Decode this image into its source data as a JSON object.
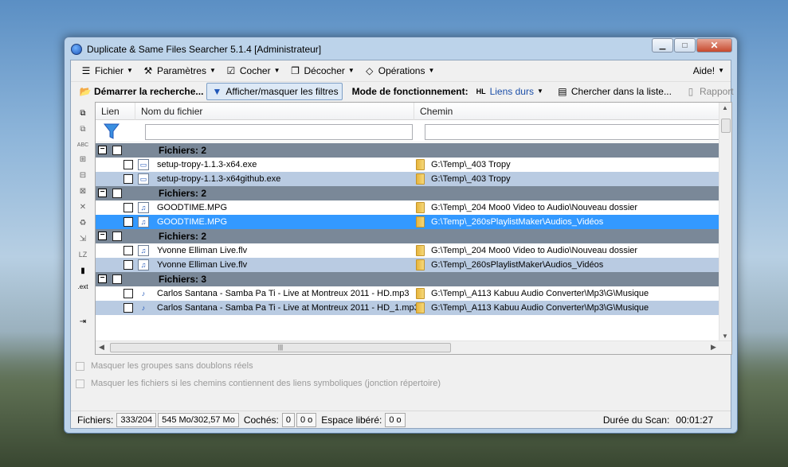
{
  "window": {
    "title": "Duplicate & Same Files Searcher 5.1.4 [Administrateur]",
    "minimize_glyph": "▁",
    "maximize_glyph": "□",
    "close_glyph": "✕"
  },
  "menu": {
    "items": [
      {
        "label": "Fichier",
        "icon": "file-menu-icon"
      },
      {
        "label": "Paramètres",
        "icon": "settings-tools-icon"
      },
      {
        "label": "Cocher",
        "icon": "check-menu-icon"
      },
      {
        "label": "Décocher",
        "icon": "uncheck-menu-icon"
      },
      {
        "label": "Opérations",
        "icon": "operations-icon"
      }
    ],
    "help": "Aide!"
  },
  "toolbar": {
    "start_search": "Démarrer la recherche...",
    "toggle_filters": "Afficher/masquer les filtres",
    "mode_label": "Mode de fonctionnement:",
    "mode_value": "Liens durs",
    "mode_icon_text": "HL",
    "search_list": "Chercher dans la liste...",
    "report": "Rapport"
  },
  "grid": {
    "columns": [
      "Lien",
      "Nom du fichier",
      "Chemin"
    ],
    "group_label": "Fichiers:",
    "groups": [
      {
        "count": "2",
        "files": [
          {
            "name": "setup-tropy-1.1.3-x64.exe",
            "path": "G:\\Temp\\_403 Tropy",
            "style": "white",
            "icon": "executable-file-icon"
          },
          {
            "name": "setup-tropy-1.1.3-x64github.exe",
            "path": "G:\\Temp\\_403 Tropy",
            "style": "alt",
            "icon": "executable-file-icon"
          }
        ]
      },
      {
        "count": "2",
        "files": [
          {
            "name": "GOODTIME.MPG",
            "path": "G:\\Temp\\_204 Moo0 Video to Audio\\Nouveau dossier",
            "style": "white",
            "icon": "video-file-icon"
          },
          {
            "name": "GOODTIME.MPG",
            "path": "G:\\Temp\\_260sPlaylistMaker\\Audios_Vidéos",
            "style": "selected",
            "icon": "video-file-icon"
          }
        ]
      },
      {
        "count": "2",
        "files": [
          {
            "name": "Yvonne Elliman Live.flv",
            "path": "G:\\Temp\\_204 Moo0 Video to Audio\\Nouveau dossier",
            "style": "white",
            "icon": "video-file-icon"
          },
          {
            "name": "Yvonne Elliman Live.flv",
            "path": "G:\\Temp\\_260sPlaylistMaker\\Audios_Vidéos",
            "style": "alt",
            "icon": "video-file-icon"
          }
        ]
      },
      {
        "count": "3",
        "files": [
          {
            "name": "Carlos Santana - Samba Pa Ti  - Live at Montreux 2011 - HD.mp3",
            "path": "G:\\Temp\\_A113  Kabuu Audio Converter\\Mp3\\G\\Musique",
            "style": "white",
            "icon": "audio-file-icon"
          },
          {
            "name": "Carlos Santana - Samba Pa Ti  - Live at Montreux 2011 - HD_1.mp3",
            "path": "G:\\Temp\\_A113  Kabuu Audio Converter\\Mp3\\G\\Musique",
            "style": "alt",
            "icon": "audio-file-icon"
          }
        ]
      }
    ]
  },
  "options": {
    "hide_groups": "Masquer les groupes sans doublons réels",
    "hide_symlinks": "Masquer les fichiers si les chemins contiennent des liens symboliques (jonction répertoire)"
  },
  "status": {
    "files_label": "Fichiers:",
    "files_count": "333/204",
    "size": "545 Mo/302,57 Mo",
    "checked_label": "Cochés:",
    "checked_count": "0",
    "checked_size": "0 o",
    "freed_label": "Espace libéré:",
    "freed_value": "0 o",
    "duration_label": "Durée du Scan:",
    "duration_value": "00:01:27"
  },
  "colors": {
    "group_row": "#7a8898",
    "alt_row": "#b9cbe2",
    "selected_row": "#3399ff"
  }
}
